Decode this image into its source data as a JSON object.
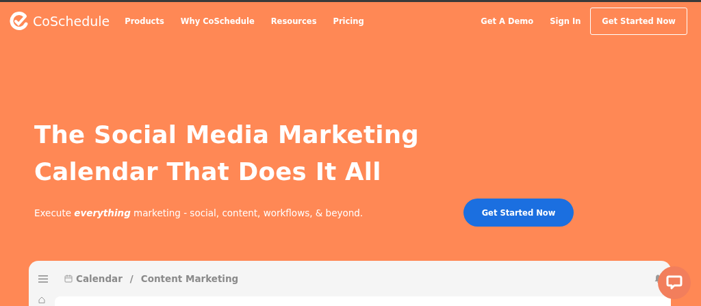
{
  "header": {
    "logo": "CoSchedule",
    "nav": [
      "Products",
      "Why CoSchedule",
      "Resources",
      "Pricing"
    ],
    "right_links": [
      "Get A Demo",
      "Sign In"
    ],
    "cta": "Get Started Now"
  },
  "hero": {
    "title_lines": [
      "The Social Media Marketing",
      "Calendar That Does It All"
    ],
    "subtitle": "Execute **everything** marketing - social, content, workflows, & beyond.",
    "cta": "Get Started Now"
  },
  "app_preview": {
    "breadcrumb": [
      "Calendar",
      "Content Marketing"
    ],
    "separator": "/"
  }
}
